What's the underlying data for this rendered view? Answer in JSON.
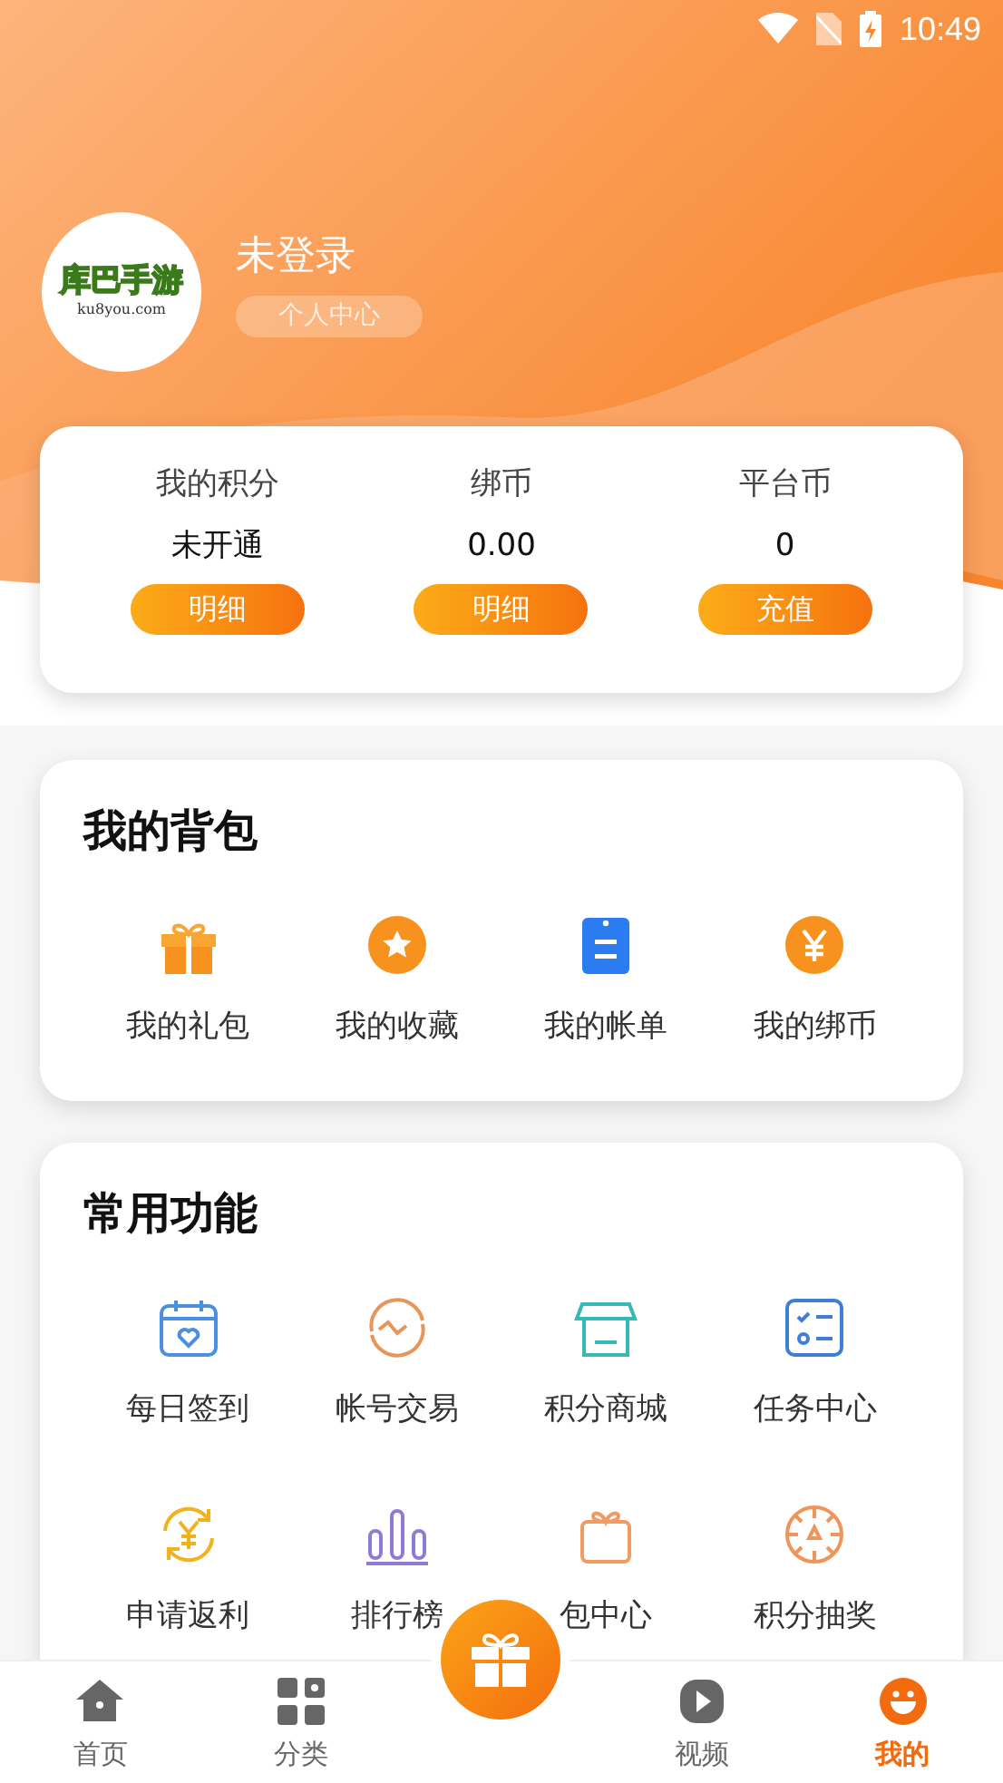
{
  "status_bar": {
    "time": "10:49"
  },
  "profile": {
    "logo_title": "库巴手游",
    "logo_url": "ku8you.com",
    "name": "未登录",
    "button": "个人中心"
  },
  "stats": [
    {
      "label": "我的积分",
      "value": "未开通",
      "button": "明细"
    },
    {
      "label": "绑币",
      "value": "0.00",
      "button": "明细"
    },
    {
      "label": "平台币",
      "value": "0",
      "button": "充值"
    }
  ],
  "backpack": {
    "title": "我的背包",
    "items": [
      {
        "kind": "gift",
        "label": "我的礼包"
      },
      {
        "kind": "star",
        "label": "我的收藏"
      },
      {
        "kind": "bill",
        "label": "我的帐单"
      },
      {
        "kind": "yen",
        "label": "我的绑币"
      }
    ]
  },
  "functions": {
    "title": "常用功能",
    "items": [
      {
        "kind": "calendar",
        "label": "每日签到"
      },
      {
        "kind": "trade",
        "label": "帐号交易"
      },
      {
        "kind": "shop",
        "label": "积分商城"
      },
      {
        "kind": "tasks",
        "label": "任务中心"
      },
      {
        "kind": "rebate",
        "label": "申请返利"
      },
      {
        "kind": "rank",
        "label": "排行榜"
      },
      {
        "kind": "giftbox",
        "label": "包中心"
      },
      {
        "kind": "wheel",
        "label": "积分抽奖"
      }
    ]
  },
  "nav": [
    {
      "kind": "home",
      "label": "首页",
      "selected": false
    },
    {
      "kind": "grid",
      "label": "分类",
      "selected": false
    },
    {
      "kind": "center"
    },
    {
      "kind": "video",
      "label": "视频",
      "selected": false
    },
    {
      "kind": "me",
      "label": "我的",
      "selected": true
    }
  ]
}
